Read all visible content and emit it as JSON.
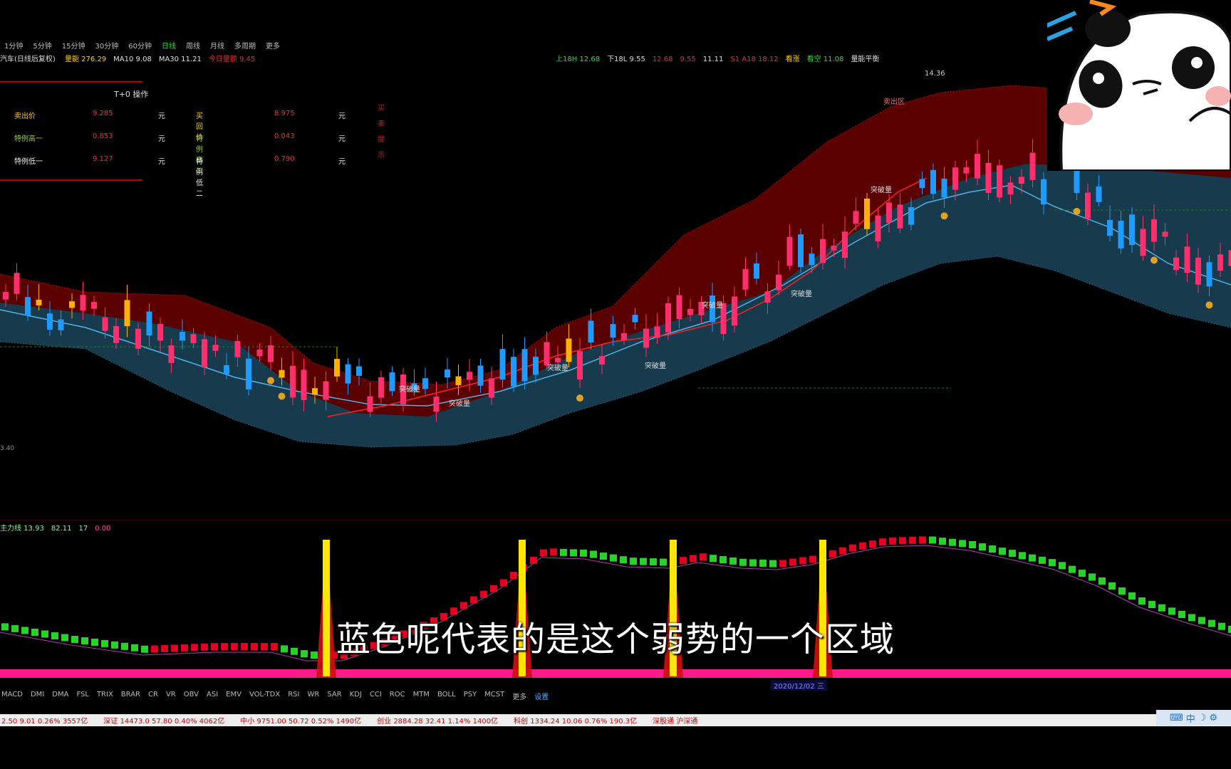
{
  "toolbar": {
    "periods": [
      "1分钟",
      "5分钟",
      "15分钟",
      "30分钟",
      "60分钟",
      "日线",
      "周线",
      "月线",
      "多周期",
      "更多"
    ],
    "active_period": "日线"
  },
  "indicator_line": {
    "stock_name": "汽车(日线后复权)",
    "items": [
      {
        "label": "量能",
        "value": "276.29",
        "color": "#ffd000"
      },
      {
        "label": "MA10",
        "value": "9.08",
        "color": "#e0e0e0"
      },
      {
        "label": "MA30",
        "value": "11.21",
        "color": "#e0e0e0"
      },
      {
        "label": "今日量额",
        "value": "9.45",
        "color": "#d33"
      }
    ],
    "right": [
      {
        "label": "上18H",
        "value": "12.68",
        "color": "#39d353"
      },
      {
        "label": "下18L",
        "value": "9.55",
        "color": "#dddddd"
      },
      {
        "label": "",
        "value": "12.68",
        "color": "#d33"
      },
      {
        "label": "",
        "value": "9.55",
        "color": "#d33"
      },
      {
        "label": "",
        "value": "11.11",
        "color": "#ddd"
      },
      {
        "label": "S1",
        "value": "A18 18.12",
        "color": "#d33"
      },
      {
        "label": "看涨",
        "value": "",
        "color": "#ffd000"
      },
      {
        "label": "看空",
        "value": "11.08",
        "color": "#39d353"
      },
      {
        "label": "量能平衡",
        "value": "",
        "color": "#ddd"
      }
    ]
  },
  "t0_panel": {
    "title": "T+0 操作",
    "rows": [
      {
        "a": "卖出价",
        "av": "9.285",
        "au": "元",
        "b": "买回价",
        "bv": "8.975",
        "bu": "元",
        "color": "#ffd000"
      },
      {
        "a": "特例高一",
        "av": "0.853",
        "au": "元",
        "b": "特例高二",
        "bv": "0.043",
        "bu": "元",
        "color": "#9ec64f"
      },
      {
        "a": "特例低一",
        "av": "9.127",
        "au": "元",
        "b": "特例低二",
        "bv": "0.790",
        "bu": "元",
        "color": "#eeeeee"
      }
    ],
    "side_chars": [
      "买",
      "卖",
      "提",
      "示"
    ]
  },
  "price_labels": {
    "peak": "14.36",
    "sell_zone": "卖出区",
    "low": "3.40",
    "annotations": [
      "突破量",
      "突破量",
      "突破量",
      "突破量",
      "突破量",
      "突破量",
      "突破量"
    ]
  },
  "osc_header": {
    "items": [
      {
        "label": "主力线",
        "value": "13.93",
        "color": "#9e9"
      },
      {
        "label": "",
        "value": "82.11",
        "color": "#9e9"
      },
      {
        "label": "",
        "value": "17",
        "color": "#9e9"
      },
      {
        "label": "",
        "value": "0.00",
        "color": "#ff4fa8"
      }
    ]
  },
  "bottom_tabs": [
    "MACD",
    "DMI",
    "DMA",
    "FSL",
    "TRIX",
    "BRAR",
    "CR",
    "VR",
    "OBV",
    "ASI",
    "EMV",
    "VOL-TDX",
    "RSI",
    "WR",
    "SAR",
    "KDJ",
    "CCI",
    "ROC",
    "MTM",
    "BOLL",
    "PSY",
    "MCST",
    "更多",
    "设置"
  ],
  "date_badge": "2020/12/02 三",
  "ticker": [
    "2.50 9.01 0.26% 3557亿",
    "深证 14473.0 57.80 0.40% 4062亿",
    "中小 9751.00 50.72 0.52% 1490亿",
    "创业 2884.28 32.41 1.14% 1400亿",
    "科创 1334.24 10.06 0.76% 190.3亿",
    "深股通 沪深通"
  ],
  "subtitle": "蓝色呢代表的是这个弱势的一个区域",
  "colors": {
    "up": "#ff2f6d",
    "down": "#1f9bff",
    "band_upper": "#5a0000",
    "band_lower": "#173a4c",
    "osc_up": "#e6001f",
    "osc_down": "#28d22a",
    "baseline": "#ff1a8c",
    "spike": "#ffe600"
  },
  "icons": [
    "panda-sticker-icon",
    "tray-icons"
  ]
}
